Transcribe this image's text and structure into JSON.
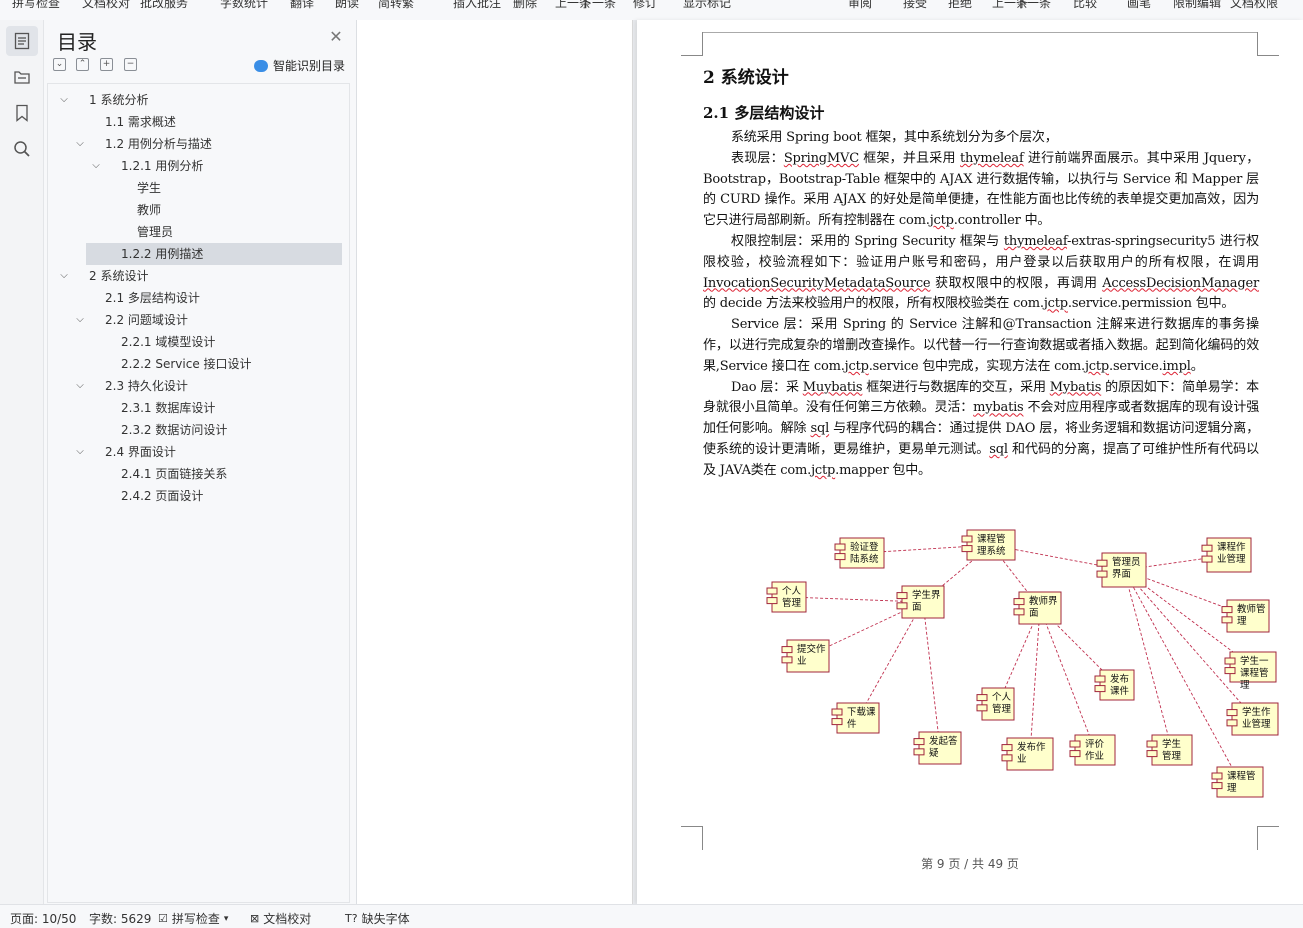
{
  "ribbon": {
    "items": [
      "拼写检查",
      "文档校对",
      "批改服务",
      "字数统计",
      "翻译",
      "朗读",
      "简转繁",
      "插入批注",
      "删除",
      "上一条",
      "下一条",
      "修订",
      "显示标记",
      "审阅",
      "接受",
      "拒绝",
      "上一条",
      "下一条",
      "比较",
      "画笔",
      "限制编辑",
      "文档权限"
    ]
  },
  "rail": {
    "icons": [
      "toc-icon",
      "navigation-icon",
      "bookmark-icon",
      "search-icon"
    ]
  },
  "toc": {
    "title": "目录",
    "smart_label": "智能识别目录",
    "items": [
      {
        "arrow": "∨",
        "label": "1  系统分析"
      },
      {
        "arrow": "",
        "label": "1.1  需求概述"
      },
      {
        "arrow": "∨",
        "label": "1.2  用例分析与描述"
      },
      {
        "arrow": "∨",
        "label": "1.2.1  用例分析"
      },
      {
        "arrow": "",
        "label": "学生"
      },
      {
        "arrow": "",
        "label": "教师"
      },
      {
        "arrow": "",
        "label": "管理员"
      },
      {
        "arrow": "",
        "label": "1.2.2  用例描述"
      },
      {
        "arrow": "∨",
        "label": "2  系统设计"
      },
      {
        "arrow": "",
        "label": "2.1  多层结构设计"
      },
      {
        "arrow": "∨",
        "label": "2.2  问题域设计"
      },
      {
        "arrow": "",
        "label": "2.2.1  域模型设计"
      },
      {
        "arrow": "",
        "label": "2.2.2    Service 接口设计"
      },
      {
        "arrow": "∨",
        "label": "2.3  持久化设计"
      },
      {
        "arrow": "",
        "label": "2.3.1  数据库设计"
      },
      {
        "arrow": "",
        "label": "2.3.2  数据访问设计"
      },
      {
        "arrow": "∨",
        "label": "2.4  界面设计"
      },
      {
        "arrow": "",
        "label": "2.4.1  页面链接关系"
      },
      {
        "arrow": "",
        "label": "2.4.2  页面设计"
      }
    ]
  },
  "document": {
    "heading1": "2  系统设计",
    "heading2": "2.1  多层结构设计",
    "paragraphs": [
      "系统采用 Spring boot 框架，其中系统划分为多个层次，",
      "表现层：SpringMVC 框架，并且采用 thymeleaf 进行前端界面展示。其中采用 Jquery，Bootstrap，Bootstrap-Table 框架中的 AJAX 进行数据传输，以执行与 Service 和 Mapper 层的 CURD 操作。采用 AJAX 的好处是简单便捷，在性能方面也比传统的表单提交更加高效，因为它只进行局部刷新。所有控制器在 com.jctp.controller 中。",
      "权限控制层：采用的 Spring Security 框架与 thymeleaf-extras-springsecurity5 进行权限校验，校验流程如下：验证用户账号和密码，用户登录以后获取用户的所有权限，在调用 InvocationSecurityMetadataSource 获取权限中的权限，再调用 AccessDecisionManager 的 decide 方法来校验用户的权限，所有权限校验类在 com.jctp.service.permission 包中。",
      "Service 层：采用 Spring 的 Service 注解和@Transaction 注解来进行数据库的事务操作，以进行完成复杂的增删改查操作。以代替一行一行查询数据或者插入数据。起到简化编码的效果,Service 接口在 com.jctp.service 包中完成，实现方法在 com.jctp.service.impl。",
      "Dao 层：采 Muybatis 框架进行与数据库的交互，采用 Mybatis 的原因如下：简单易学：本身就很小且简单。没有任何第三方依赖。灵活：mybatis 不会对应用程序或者数据库的现有设计强加任何影响。解除 sql 与程序代码的耦合：通过提供 DAO 层，将业务逻辑和数据访问逻辑分离，使系统的设计更清晰，更易维护，更易单元测试。sql 和代码的分离，提高了可维护性所有代码以及 JAVA类在 com.jctp.mapper 包中。"
    ],
    "diagram_nodes": [
      "课程管理系统",
      "验证登陆系统",
      "管理员界面",
      "课程作业管理",
      "个人管理",
      "学生界面",
      "教师界面",
      "教师管理",
      "提交作业",
      "学生一课程管理",
      "发布课件",
      "下载课件",
      "个人管理",
      "学生作业管理",
      "发起答疑",
      "发布作业",
      "评价作业",
      "学生管理",
      "课程管理"
    ],
    "footer": "第 9 页 / 共 49 页"
  },
  "status": {
    "page": "页面: 10/50",
    "words": "字数: 5629",
    "spell": "拼写检查",
    "proof": "文档校对",
    "font": "缺失字体"
  },
  "colors": {
    "node_fill": "#ffffcc",
    "node_border": "#a0243b",
    "edge": "#c0304f",
    "toc_selected": "#d7dbe1"
  }
}
